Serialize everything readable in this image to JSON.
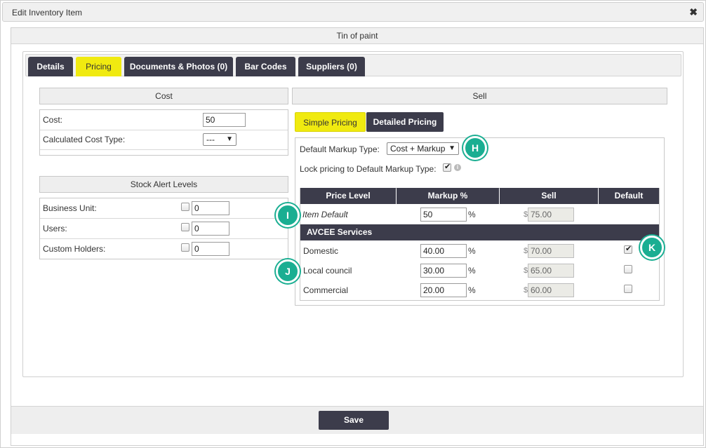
{
  "window": {
    "title": "Edit Inventory Item",
    "close_glyph": "✖"
  },
  "item": {
    "name": "Tin of paint"
  },
  "tabs": [
    {
      "label": "Details"
    },
    {
      "label": "Pricing"
    },
    {
      "label": "Documents & Photos (0)"
    },
    {
      "label": "Bar Codes"
    },
    {
      "label": "Suppliers (0)"
    }
  ],
  "cost": {
    "header": "Cost",
    "cost_label": "Cost:",
    "cost_value": "50",
    "calc_type_label": "Calculated Cost Type:",
    "calc_type_value": "---"
  },
  "stock_alert": {
    "header": "Stock Alert Levels",
    "rows": [
      {
        "label": "Business Unit:",
        "value": "0"
      },
      {
        "label": "Users:",
        "value": "0"
      },
      {
        "label": "Custom Holders:",
        "value": "0"
      }
    ]
  },
  "sell": {
    "header": "Sell",
    "simple_pricing": "Simple Pricing",
    "detailed_pricing": "Detailed Pricing",
    "default_markup_label": "Default Markup Type:",
    "default_markup_value": "Cost + Markup",
    "lock_label": "Lock pricing to Default Markup Type:",
    "lock_checked": true
  },
  "price_table": {
    "columns": [
      "Price Level",
      "Markup %",
      "Sell",
      "Default"
    ],
    "item_default": {
      "label": "Item Default",
      "markup": "50",
      "sell": "75.00"
    },
    "group": "AVCEE Services",
    "rows": [
      {
        "label": "Domestic",
        "markup": "40.00",
        "sell": "70.00",
        "default": true
      },
      {
        "label": "Local council",
        "markup": "30.00",
        "sell": "65.00",
        "default": false
      },
      {
        "label": "Commercial",
        "markup": "20.00",
        "sell": "60.00",
        "default": false
      }
    ],
    "percent_sign": "%",
    "currency_sign": "$"
  },
  "markers": [
    "H",
    "I",
    "J",
    "K"
  ],
  "footer": {
    "save_label": "Save"
  },
  "colors": {
    "accent": "#f0ea10",
    "dark": "#3c3c4b",
    "marker": "#1aae92"
  }
}
